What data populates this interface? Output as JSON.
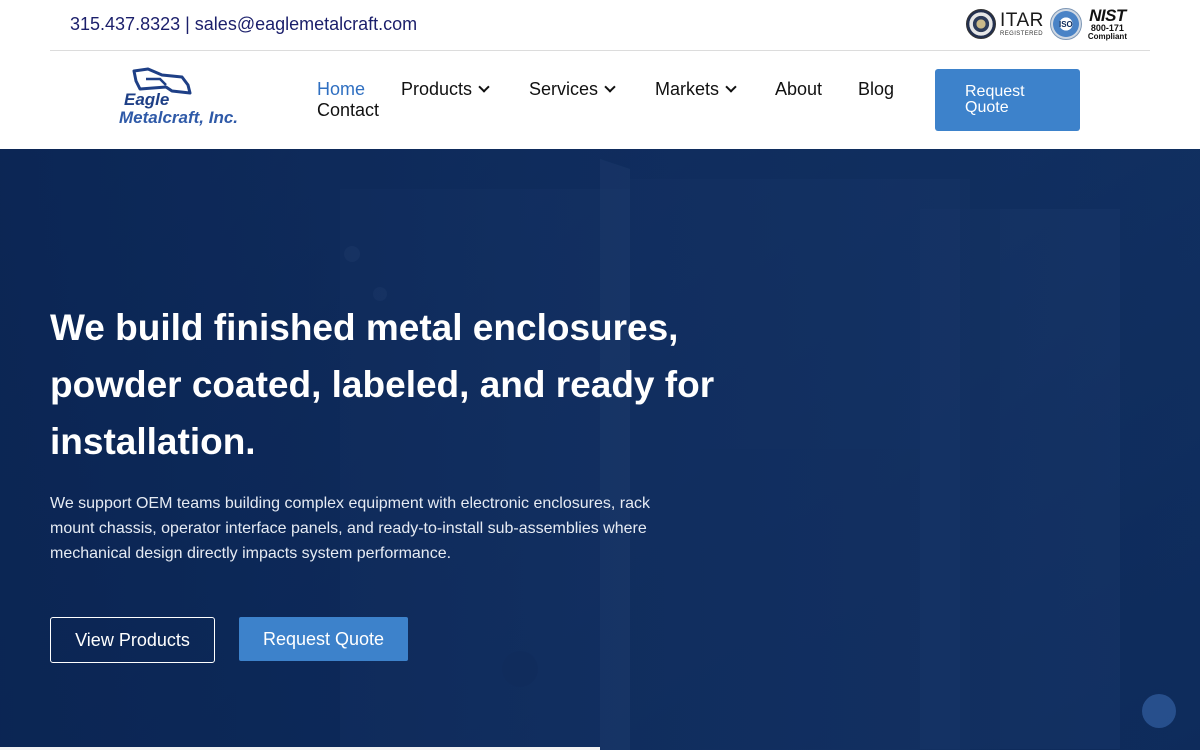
{
  "topbar": {
    "phone": "315.437.8323",
    "separator": " | ",
    "email": "sales@eaglemetalcraft.com",
    "certifications": {
      "itar": "ITAR",
      "itar_sub": "REGISTERED",
      "iso": "ISO",
      "nist": "NIST",
      "nist_number": "800-171",
      "nist_sub": "Compliant"
    }
  },
  "logo": {
    "line1": "Eagle",
    "line2": "Metalcraft, Inc."
  },
  "nav": {
    "items": [
      {
        "label": "Home",
        "active": true
      },
      {
        "label": "Products",
        "dropdown": true
      },
      {
        "label": "Services",
        "dropdown": true
      },
      {
        "label": "Markets",
        "dropdown": true
      },
      {
        "label": "About"
      },
      {
        "label": "Blog"
      },
      {
        "label": "Contact"
      }
    ],
    "quote_button": "Request Quote"
  },
  "hero": {
    "title": "We build finished metal enclosures, powder coated, labeled, and ready for installation.",
    "description": "We support OEM teams building complex equipment with electronic enclosures, rack mount chassis, operator interface panels, and ready-to-install sub-assemblies where mechanical design directly impacts system performance.",
    "primary_button": "View Products",
    "secondary_button": "Request Quote"
  },
  "colors": {
    "accent": "#3d82cb",
    "nav_active": "#2f6fc1",
    "contact_text": "#1b1f6b",
    "hero_bg": "#0b2757"
  },
  "icons": [
    "itar-seal-icon",
    "iso-badge-icon",
    "chevron-down-icon",
    "chat-bubble-icon"
  ]
}
